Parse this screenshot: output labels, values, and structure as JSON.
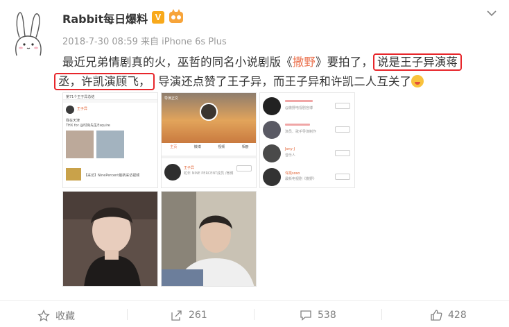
{
  "post": {
    "username": "Rabbit每日爆料",
    "verified_badge": "V",
    "meta": "2018-7-30 08:59 来自 iPhone 6s Plus",
    "text": {
      "seg1": "最近兄弟情剧真的火，巫哲的同名小说剧版《",
      "link": "撒野",
      "seg2": "》要拍了，",
      "hl1": "说是王子异演蒋",
      "hl2": "丞，许凯演顾飞，",
      "seg3": "导演还点赞了王子异，而王子异和许凯二人互关了"
    },
    "icons": {
      "avatar": "rabbit-avatar",
      "fan_badge": "fan-badge-icon",
      "menu": "chevron-down-icon",
      "emoji": "drooling-emoji"
    }
  },
  "thumbs": {
    "t1": {
      "header": "第71个王子异总结",
      "name": "王子异",
      "caption": "我在天津",
      "thx": "THX for @时尚先生Esquire",
      "footer": "【采访】NinePercent最新采访视频"
    },
    "t2": {
      "back": "导演正文",
      "tabs": [
        "主页",
        "微博",
        "视频",
        "相册"
      ],
      "name": "王子异",
      "desc": "蛇年 NINE PERCENT成员 /微博"
    },
    "t3": {
      "rows": [
        {
          "name": "",
          "desc": "@撒野电视剧官博"
        },
        {
          "name": "",
          "desc": "演员、歌手导演制作"
        },
        {
          "name": "Jony-J",
          "desc": "音乐人"
        },
        {
          "name": "许凯soso",
          "desc": "最新电视剧《撒野》"
        }
      ],
      "follow": "+关注"
    }
  },
  "footer": {
    "favorite": "收藏",
    "share": "261",
    "comment": "538",
    "like": "428"
  }
}
